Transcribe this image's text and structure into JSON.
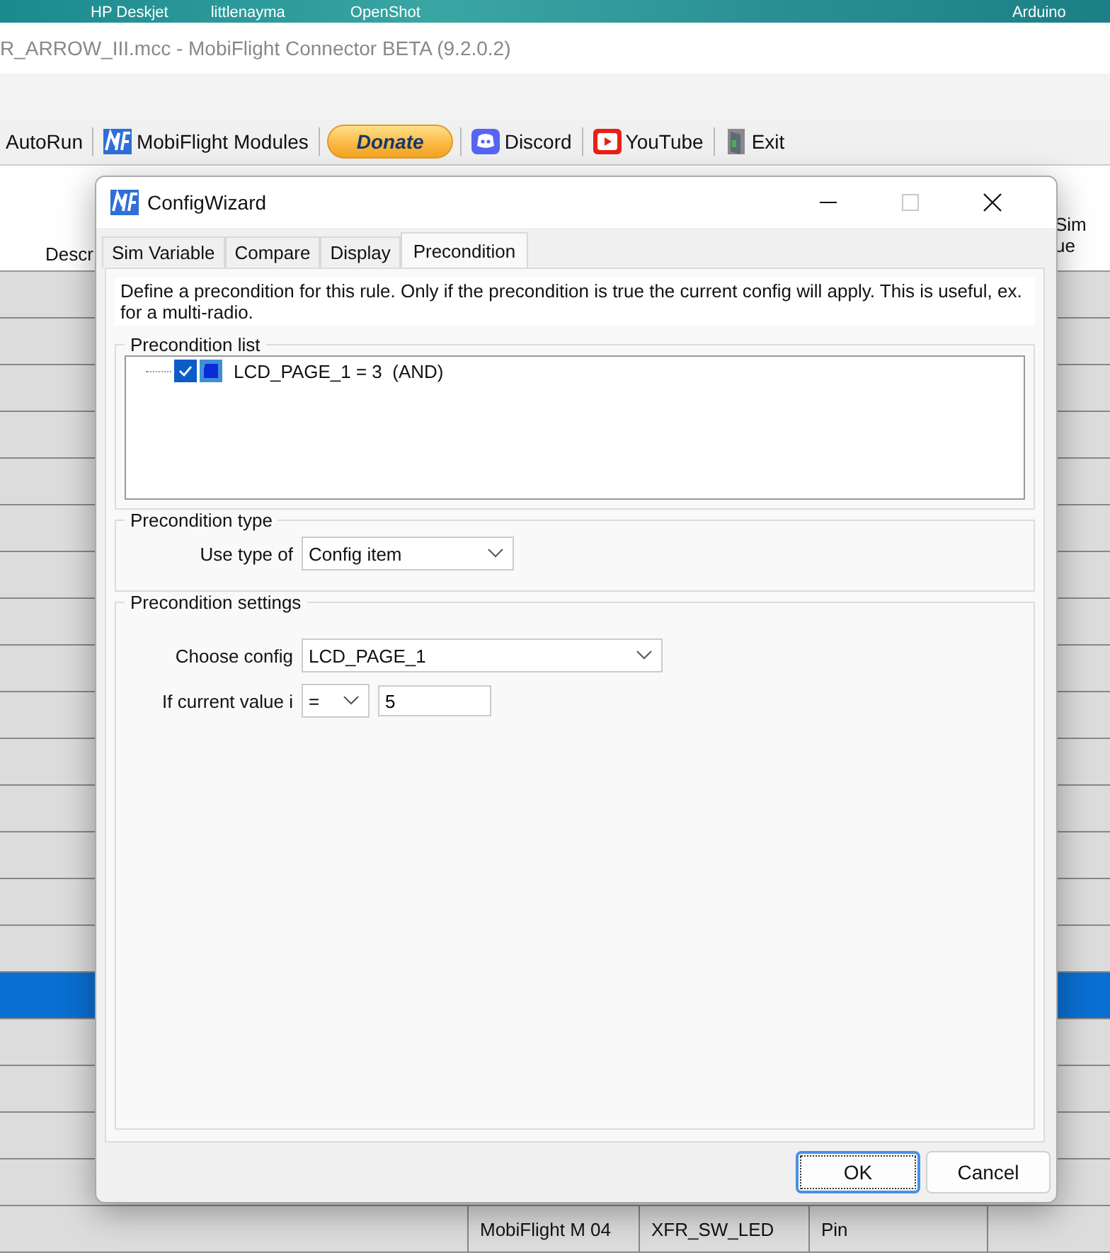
{
  "desktop_icons": [
    "HP Deskjet",
    "littlenayma",
    "OpenShot",
    "Arduino"
  ],
  "window": {
    "title": "R_ARROW_III.mcc - MobiFlight Connector BETA (9.2.0.2)"
  },
  "toolbar": [
    {
      "label": "AutoRun",
      "kind": "text"
    },
    {
      "label": "MobiFlight Modules",
      "kind": "mf"
    },
    {
      "label": "Donate",
      "kind": "donate"
    },
    {
      "label": "Discord",
      "kind": "discord"
    },
    {
      "label": "YouTube",
      "kind": "youtube"
    },
    {
      "label": "Exit",
      "kind": "exit"
    }
  ],
  "table": {
    "column_1": "Descr",
    "column_6": "Sim\nue",
    "rows": [
      {
        "selected": false
      },
      {
        "selected": false
      },
      {
        "selected": false
      },
      {
        "selected": false
      },
      {
        "selected": false
      },
      {
        "selected": false
      },
      {
        "selected": false
      },
      {
        "selected": false
      },
      {
        "selected": false
      },
      {
        "selected": false
      },
      {
        "selected": false
      },
      {
        "selected": false
      },
      {
        "selected": false
      },
      {
        "selected": false
      },
      {
        "selected": false
      },
      {
        "selected": true
      },
      {
        "selected": false
      },
      {
        "selected": false
      },
      {
        "selected": false
      },
      {
        "selected": false
      },
      {
        "selected": false,
        "cells": [
          "MobiFlight M 04",
          "XFR_SW_LED",
          "Pin"
        ]
      }
    ]
  },
  "dialog": {
    "title": "ConfigWizard",
    "maximize_disabled": true,
    "tabs": [
      {
        "label": "Sim Variable",
        "selected": false
      },
      {
        "label": "Compare",
        "selected": false
      },
      {
        "label": "Display",
        "selected": false
      },
      {
        "label": "Precondition",
        "selected": true
      }
    ],
    "description": "Define a precondition for this rule. Only if the precondition is true the current config will apply. This is useful, ex. for a multi-radio.",
    "precondition_list": {
      "title": "Precondition list",
      "items": [
        {
          "label": "LCD_PAGE_1 = 3  (AND)",
          "checked": true
        }
      ]
    },
    "precondition_type": {
      "title": "Precondition type",
      "label": "Use type of",
      "value": "Config item"
    },
    "precondition_settings": {
      "title": "Precondition settings",
      "choose_label": "Choose config",
      "choose_value": "LCD_PAGE_1",
      "compare_label": "If current value i",
      "operator": "=",
      "value": "5"
    },
    "buttons": [
      {
        "label": "OK",
        "default": true
      },
      {
        "label": "Cancel",
        "default": false
      }
    ]
  }
}
